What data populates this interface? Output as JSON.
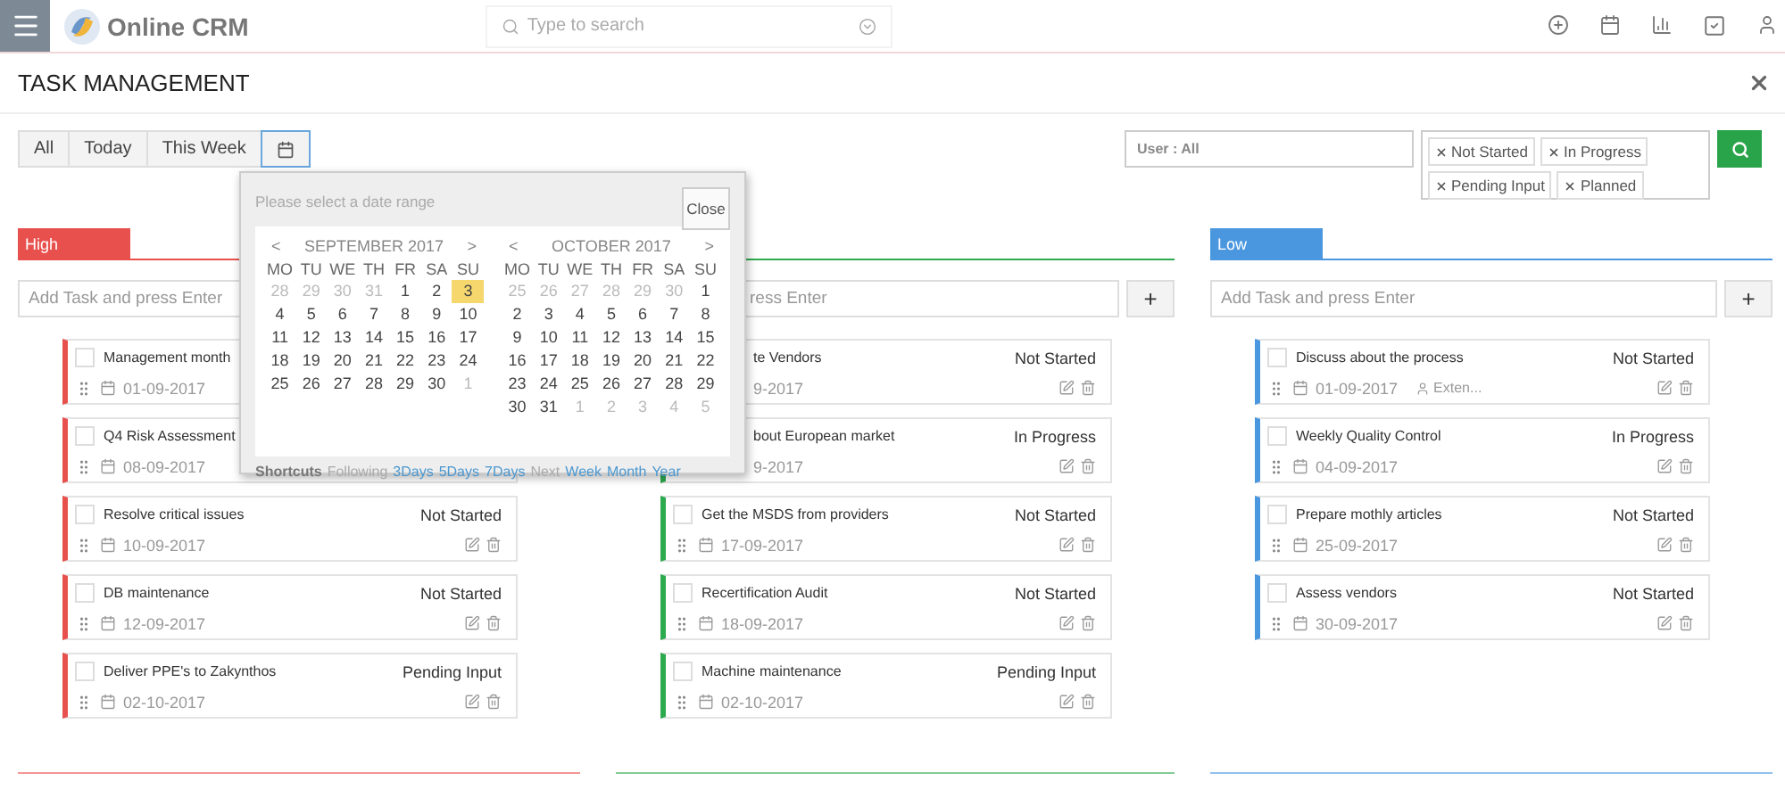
{
  "topbar": {
    "brand": "Online CRM",
    "search": {
      "placeholder": "Type to search"
    }
  },
  "page": {
    "title": "TASK MANAGEMENT"
  },
  "filters": {
    "periods": [
      {
        "kind": "text",
        "label": "All",
        "selected": false
      },
      {
        "kind": "text",
        "label": "Today",
        "selected": false
      },
      {
        "kind": "text",
        "label": "This Week",
        "selected": false
      },
      {
        "kind": "calendar",
        "selected": true
      }
    ],
    "user": "User : All",
    "statuses": [
      "Not Started",
      "In Progress",
      "Pending Input",
      "Planned"
    ]
  },
  "columns": [
    {
      "label": "High",
      "color": "#e8504d",
      "partly_hidden": false,
      "add_placeholder": "Add Task and press Enter",
      "cards": [
        {
          "title": "Management month",
          "checked": false,
          "date": "01-09-2017",
          "partly_hidden": false
        },
        {
          "title": "Q4 Risk Assessment",
          "checked": false,
          "date": "08-09-2017",
          "partly_hidden": false
        },
        {
          "title": "Resolve critical issues",
          "checked": false,
          "status": "Not Started",
          "date": "10-09-2017",
          "partly_hidden": false,
          "actions": true
        },
        {
          "title": "DB maintenance",
          "checked": false,
          "status": "Not Started",
          "date": "12-09-2017",
          "partly_hidden": false,
          "actions": true
        },
        {
          "title": "Deliver PPE's to Zakynthos",
          "checked": false,
          "status": "Pending Input",
          "date": "02-10-2017",
          "partly_hidden": false,
          "actions": true
        }
      ]
    },
    {
      "color": "#2eaa4e",
      "partly_hidden": true,
      "add_placeholder": "ress Enter",
      "add_button": "+",
      "cards": [
        {
          "title": "te Vendors",
          "status": "Not Started",
          "date": "9-2017",
          "partly_hidden": true,
          "actions": true
        },
        {
          "title": "bout European market",
          "status": "In Progress",
          "date": "9-2017",
          "partly_hidden": true,
          "actions": true
        },
        {
          "title": "Get the MSDS from providers",
          "checked": false,
          "status": "Not Started",
          "date": "17-09-2017",
          "partly_hidden": false,
          "actions": true
        },
        {
          "title": "Recertification Audit",
          "checked": false,
          "status": "Not Started",
          "date": "18-09-2017",
          "partly_hidden": false,
          "actions": true
        },
        {
          "title": "Machine maintenance",
          "checked": false,
          "status": "Pending Input",
          "date": "02-10-2017",
          "partly_hidden": false,
          "actions": true
        }
      ]
    },
    {
      "label": "Low",
      "color": "#4a97e0",
      "partly_hidden": false,
      "add_placeholder": "Add Task and press Enter",
      "add_button": "+",
      "cards": [
        {
          "title": "Discuss about the process",
          "checked": false,
          "status": "Not Started",
          "date": "01-09-2017",
          "assignee": "Exten...",
          "partly_hidden": false,
          "actions": true
        },
        {
          "title": "Weekly Quality Control",
          "checked": false,
          "status": "In Progress",
          "date": "04-09-2017",
          "partly_hidden": false,
          "actions": true
        },
        {
          "title": "Prepare mothly articles",
          "checked": false,
          "status": "Not Started",
          "date": "25-09-2017",
          "partly_hidden": false,
          "actions": true
        },
        {
          "title": "Assess vendors",
          "checked": false,
          "status": "Not Started",
          "date": "30-09-2017",
          "partly_hidden": false,
          "actions": true
        }
      ]
    }
  ],
  "date_picker": {
    "prompt": "Please select a date range",
    "close": "Close",
    "months": [
      {
        "prev": "<",
        "title": "SEPTEMBER 2017",
        "next": ">",
        "weekdays": [
          "MO",
          "TU",
          "WE",
          "TH",
          "FR",
          "SA",
          "SU"
        ],
        "days": [
          {
            "d": "28",
            "muted": true,
            "selected": false
          },
          {
            "d": "29",
            "muted": true,
            "selected": false
          },
          {
            "d": "30",
            "muted": true,
            "selected": false
          },
          {
            "d": "31",
            "muted": true,
            "selected": false
          },
          {
            "d": "1",
            "muted": false,
            "selected": false
          },
          {
            "d": "2",
            "muted": false,
            "selected": false
          },
          {
            "d": "3",
            "muted": false,
            "selected": true
          },
          {
            "d": "4",
            "muted": false,
            "selected": false
          },
          {
            "d": "5",
            "muted": false,
            "selected": false
          },
          {
            "d": "6",
            "muted": false,
            "selected": false
          },
          {
            "d": "7",
            "muted": false,
            "selected": false
          },
          {
            "d": "8",
            "muted": false,
            "selected": false
          },
          {
            "d": "9",
            "muted": false,
            "selected": false
          },
          {
            "d": "10",
            "muted": false,
            "selected": false
          },
          {
            "d": "11",
            "muted": false,
            "selected": false
          },
          {
            "d": "12",
            "muted": false,
            "selected": false
          },
          {
            "d": "13",
            "muted": false,
            "selected": false
          },
          {
            "d": "14",
            "muted": false,
            "selected": false
          },
          {
            "d": "15",
            "muted": false,
            "selected": false
          },
          {
            "d": "16",
            "muted": false,
            "selected": false
          },
          {
            "d": "17",
            "muted": false,
            "selected": false
          },
          {
            "d": "18",
            "muted": false,
            "selected": false
          },
          {
            "d": "19",
            "muted": false,
            "selected": false
          },
          {
            "d": "20",
            "muted": false,
            "selected": false
          },
          {
            "d": "21",
            "muted": false,
            "selected": false
          },
          {
            "d": "22",
            "muted": false,
            "selected": false
          },
          {
            "d": "23",
            "muted": false,
            "selected": false
          },
          {
            "d": "24",
            "muted": false,
            "selected": false
          },
          {
            "d": "25",
            "muted": false,
            "selected": false
          },
          {
            "d": "26",
            "muted": false,
            "selected": false
          },
          {
            "d": "27",
            "muted": false,
            "selected": false
          },
          {
            "d": "28",
            "muted": false,
            "selected": false
          },
          {
            "d": "29",
            "muted": false,
            "selected": false
          },
          {
            "d": "30",
            "muted": false,
            "selected": false
          },
          {
            "d": "1",
            "muted": true,
            "selected": false
          }
        ]
      },
      {
        "prev": "<",
        "title": "OCTOBER 2017",
        "next": ">",
        "weekdays": [
          "MO",
          "TU",
          "WE",
          "TH",
          "FR",
          "SA",
          "SU"
        ],
        "days": [
          {
            "d": "25",
            "muted": true,
            "selected": false
          },
          {
            "d": "26",
            "muted": true,
            "selected": false
          },
          {
            "d": "27",
            "muted": true,
            "selected": false
          },
          {
            "d": "28",
            "muted": true,
            "selected": false
          },
          {
            "d": "29",
            "muted": true,
            "selected": false
          },
          {
            "d": "30",
            "muted": true,
            "selected": false
          },
          {
            "d": "1",
            "muted": false,
            "selected": false
          },
          {
            "d": "2",
            "muted": false,
            "selected": false
          },
          {
            "d": "3",
            "muted": false,
            "selected": false
          },
          {
            "d": "4",
            "muted": false,
            "selected": false
          },
          {
            "d": "5",
            "muted": false,
            "selected": false
          },
          {
            "d": "6",
            "muted": false,
            "selected": false
          },
          {
            "d": "7",
            "muted": false,
            "selected": false
          },
          {
            "d": "8",
            "muted": false,
            "selected": false
          },
          {
            "d": "9",
            "muted": false,
            "selected": false
          },
          {
            "d": "10",
            "muted": false,
            "selected": false
          },
          {
            "d": "11",
            "muted": false,
            "selected": false
          },
          {
            "d": "12",
            "muted": false,
            "selected": false
          },
          {
            "d": "13",
            "muted": false,
            "selected": false
          },
          {
            "d": "14",
            "muted": false,
            "selected": false
          },
          {
            "d": "15",
            "muted": false,
            "selected": false
          },
          {
            "d": "16",
            "muted": false,
            "selected": false
          },
          {
            "d": "17",
            "muted": false,
            "selected": false
          },
          {
            "d": "18",
            "muted": false,
            "selected": false
          },
          {
            "d": "19",
            "muted": false,
            "selected": false
          },
          {
            "d": "20",
            "muted": false,
            "selected": false
          },
          {
            "d": "21",
            "muted": false,
            "selected": false
          },
          {
            "d": "22",
            "muted": false,
            "selected": false
          },
          {
            "d": "23",
            "muted": false,
            "selected": false
          },
          {
            "d": "24",
            "muted": false,
            "selected": false
          },
          {
            "d": "25",
            "muted": false,
            "selected": false
          },
          {
            "d": "26",
            "muted": false,
            "selected": false
          },
          {
            "d": "27",
            "muted": false,
            "selected": false
          },
          {
            "d": "28",
            "muted": false,
            "selected": false
          },
          {
            "d": "29",
            "muted": false,
            "selected": false
          },
          {
            "d": "30",
            "muted": false,
            "selected": false
          },
          {
            "d": "31",
            "muted": false,
            "selected": false
          },
          {
            "d": "1",
            "muted": true,
            "selected": false
          },
          {
            "d": "2",
            "muted": true,
            "selected": false
          },
          {
            "d": "3",
            "muted": true,
            "selected": false
          },
          {
            "d": "4",
            "muted": true,
            "selected": false
          },
          {
            "d": "5",
            "muted": true,
            "selected": false
          }
        ]
      }
    ],
    "shortcuts": {
      "label": "Shortcuts",
      "groups": [
        {
          "label": "Following",
          "links": [
            "3Days",
            "5Days",
            "7Days"
          ]
        },
        {
          "label": "Next",
          "links": [
            "Week",
            "Month",
            "Year"
          ]
        }
      ]
    }
  }
}
